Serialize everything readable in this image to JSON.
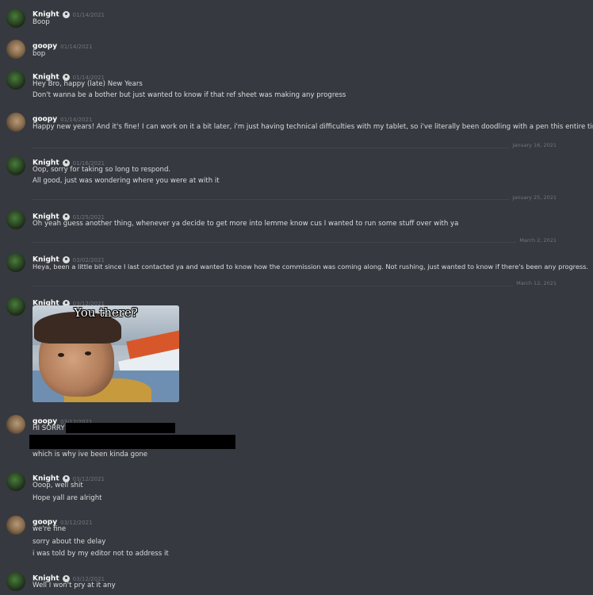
{
  "messages": [
    {
      "author": "Knight",
      "time": "01/14/2021",
      "lines": [
        "Boop"
      ]
    },
    {
      "author": "goopy",
      "time": "01/14/2021",
      "lines": [
        "bop"
      ]
    },
    {
      "author": "Knight",
      "time": "01/14/2021",
      "lines": [
        "Hey Bro, happy (late) New Years",
        "Don't wanna be a bother but just wanted to know if that ref sheet was making any progress"
      ]
    },
    {
      "author": "goopy",
      "time": "01/14/2021",
      "lines": [
        "Happy new years! And it's fine! I can work on it a bit later, i'm just having technical difficulties with my tablet, so i've literally been doodling with a pen this entire time"
      ]
    },
    {
      "author": "Knight",
      "time": "01/16/2021",
      "lines": [
        "Oop, sorry for taking so long to respond.",
        "All good, just was wondering where you were at with it"
      ]
    },
    {
      "author": "Knight",
      "time": "01/25/2021",
      "lines": [
        "Oh yeah guess another thing, whenever ya decide to get more into lemme know cus I wanted to run some stuff over with ya"
      ]
    },
    {
      "author": "Knight",
      "time": "03/02/2021",
      "lines": [
        "Heya, been a little bit since I last contacted ya and wanted to know how the commission was coming along. Not rushing, just wanted to know if there's been any progress."
      ]
    },
    {
      "author": "Knight",
      "time": "03/12/2021",
      "gif_caption": "You there?"
    },
    {
      "author": "goopy",
      "time": "03/12/2021",
      "lines": [
        "HI SORRY",
        "",
        "which is why ive been kinda gone"
      ]
    },
    {
      "author": "Knight",
      "time": "03/12/2021",
      "lines": [
        "Ooop, well shit",
        "Hope yall are alright"
      ]
    },
    {
      "author": "goopy",
      "time": "03/12/2021",
      "lines": [
        "we're fine",
        "sorry about the delay",
        "i was told by my editor not to address it"
      ]
    },
    {
      "author": "Knight",
      "time": "03/12/2021",
      "lines": [
        "Well I won't pry at it any"
      ]
    }
  ],
  "dividers": [
    "January 16, 2021",
    "January 25, 2021",
    "March 2, 2021",
    "March 12, 2021"
  ]
}
